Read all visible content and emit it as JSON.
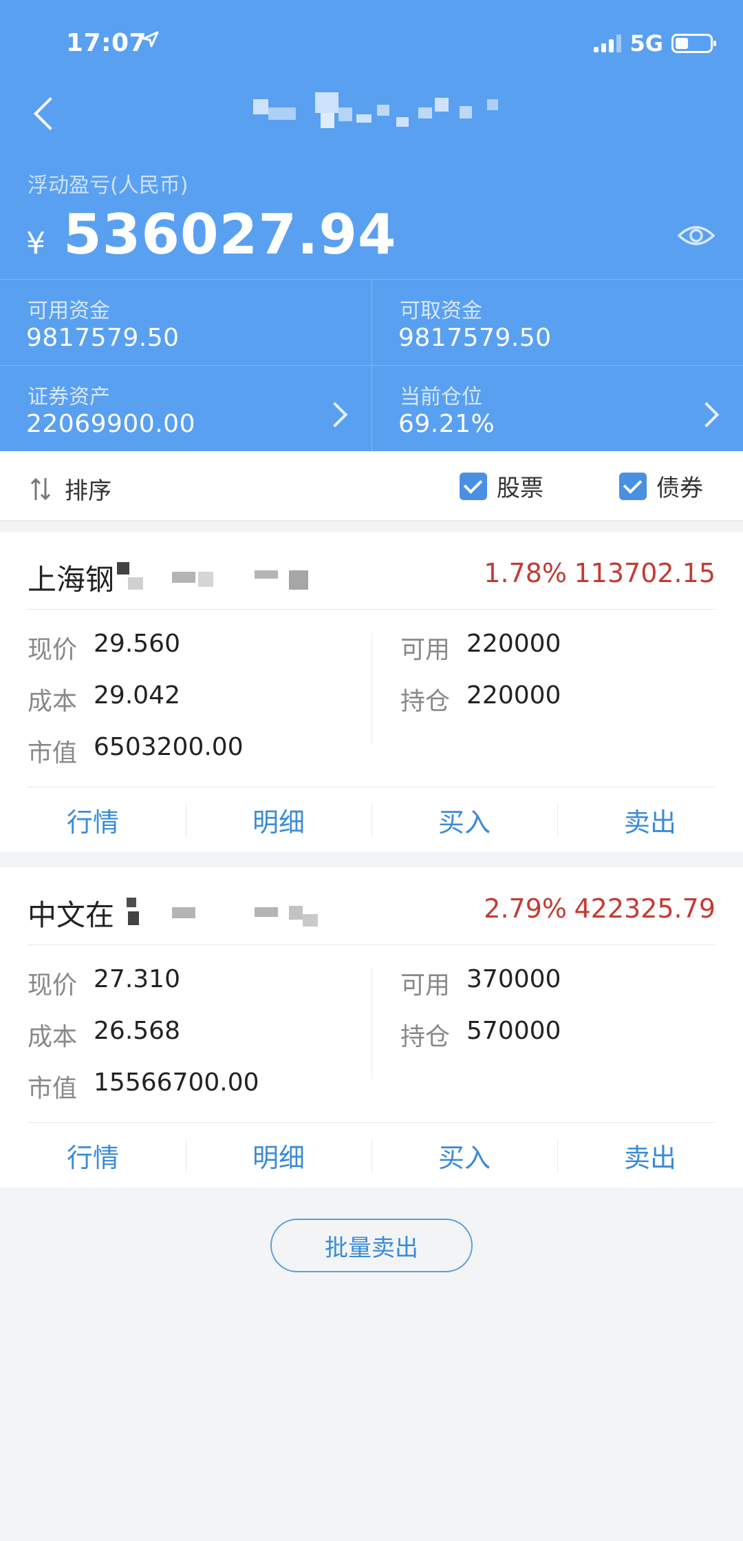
{
  "status": {
    "time": "17:07",
    "network": "5G"
  },
  "summary": {
    "pnl_label": "浮动盈亏(人民币)",
    "currency": "¥",
    "pnl_value": "536027.94",
    "cells": [
      {
        "label": "可用资金",
        "value": "9817579.50"
      },
      {
        "label": "可取资金",
        "value": "9817579.50"
      },
      {
        "label": "证券资产",
        "value": "22069900.00"
      },
      {
        "label": "当前仓位",
        "value": "69.21%"
      }
    ]
  },
  "filter": {
    "sort_label": "排序",
    "stock_label": "股票",
    "bond_label": "债券"
  },
  "holdings": [
    {
      "name": "上海钢",
      "pct": "1.78%",
      "pl": "113702.15",
      "price_label": "现价",
      "price": "29.560",
      "cost_label": "成本",
      "cost": "29.042",
      "mv_label": "市值",
      "mv": "6503200.00",
      "avail_label": "可用",
      "avail": "220000",
      "hold_label": "持仓",
      "hold": "220000"
    },
    {
      "name": "中文在",
      "pct": "2.79%",
      "pl": "422325.79",
      "price_label": "现价",
      "price": "27.310",
      "cost_label": "成本",
      "cost": "26.568",
      "mv_label": "市值",
      "mv": "15566700.00",
      "avail_label": "可用",
      "avail": "370000",
      "hold_label": "持仓",
      "hold": "570000"
    }
  ],
  "actions": {
    "quote": "行情",
    "detail": "明细",
    "buy": "买入",
    "sell": "卖出"
  },
  "batch_sell": "批量卖出",
  "colors": {
    "header_blue": "#5aa0f0",
    "loss_red": "#c43a33",
    "link_blue": "#3b8bd6"
  }
}
